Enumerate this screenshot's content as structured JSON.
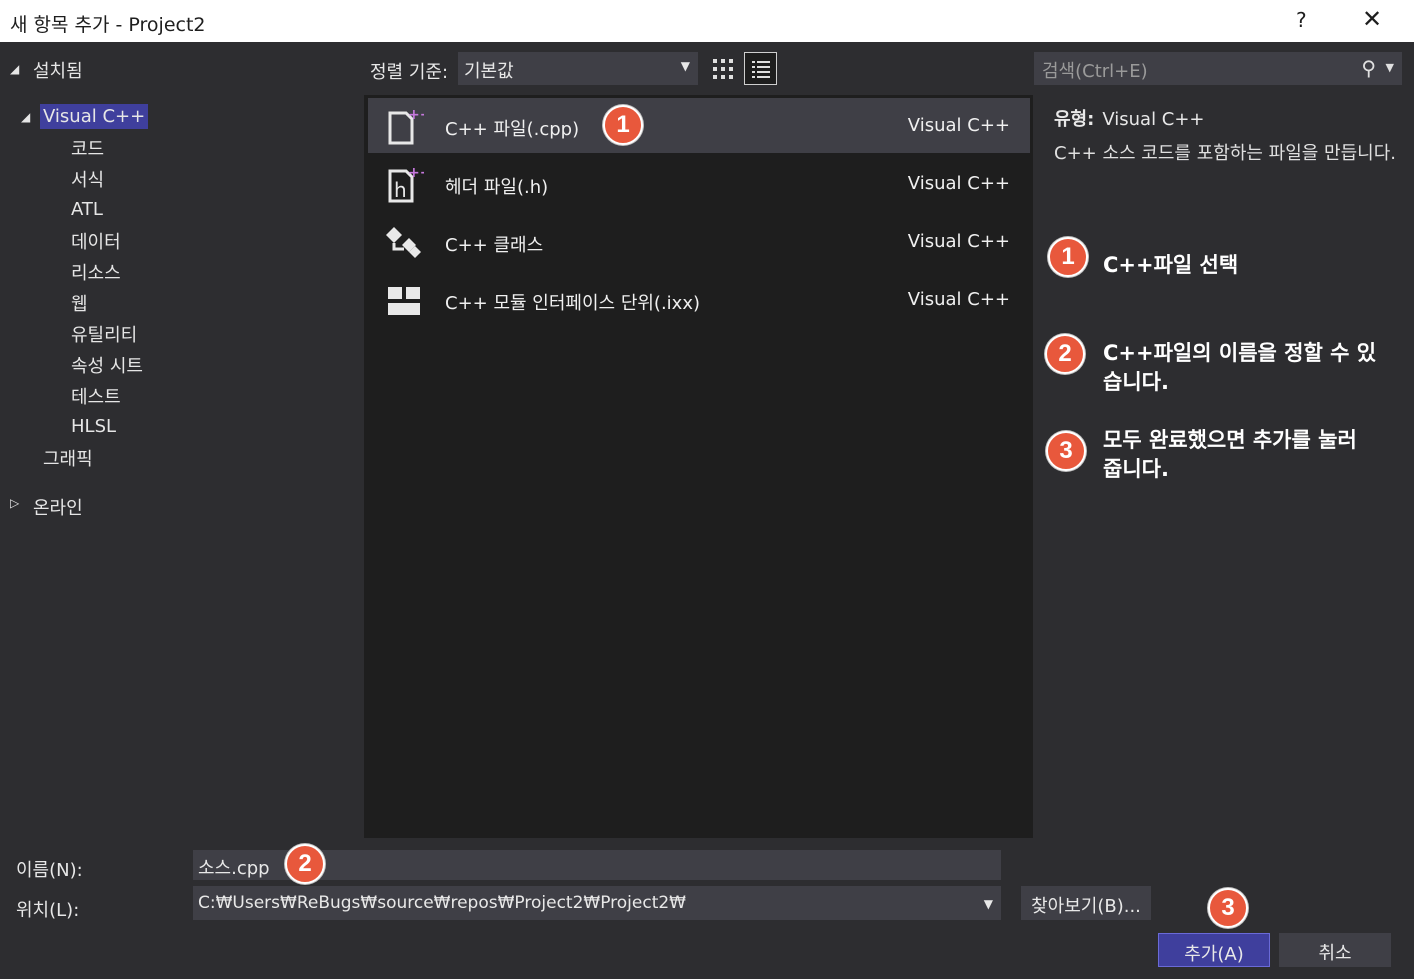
{
  "window": {
    "title": "새 항목 추가 - Project2",
    "help_label": "?",
    "close_label": "✕"
  },
  "sidebar": {
    "installed": "설치됨",
    "visual_cpp": "Visual C++",
    "children": [
      "코드",
      "서식",
      "ATL",
      "데이터",
      "리소스",
      "웹",
      "유틸리티",
      "속성 시트",
      "테스트",
      "HLSL"
    ],
    "graphics": "그래픽",
    "online": "온라인"
  },
  "toolbar": {
    "sort_label": "정렬 기준:",
    "sort_value": "기본값",
    "search_placeholder": "검색(Ctrl+E)"
  },
  "templates": [
    {
      "name": "C++ 파일(.cpp)",
      "type": "Visual C++",
      "icon": "cpp-file-icon",
      "selected": true
    },
    {
      "name": "헤더 파일(.h)",
      "type": "Visual C++",
      "icon": "header-file-icon",
      "selected": false
    },
    {
      "name": "C++ 클래스",
      "type": "Visual C++",
      "icon": "class-icon",
      "selected": false
    },
    {
      "name": "C++ 모듈 인터페이스 단위(.ixx)",
      "type": "Visual C++",
      "icon": "module-icon",
      "selected": false
    }
  ],
  "details": {
    "type_label": "유형:",
    "type_value": "Visual C++",
    "description": "C++ 소스 코드를 포함하는 파일을 만듭니다."
  },
  "annotations": {
    "badge1": "1",
    "badge2": "2",
    "badge3": "3",
    "note1": "C++파일 선택",
    "note2": "C++파일의 이름을 정할 수 있습니다.",
    "note3": "모두 완료했으면 추가를 눌러줍니다."
  },
  "form": {
    "name_label": "이름(N):",
    "name_value": "소스.cpp",
    "location_label": "위치(L):",
    "location_value": "C:₩Users₩ReBugs₩source₩repos₩Project2₩Project2₩",
    "browse_label": "찾아보기(B)...",
    "add_label": "추가(A)",
    "cancel_label": "취소"
  },
  "colors": {
    "accent": "#3f3f9d",
    "badge": "#e8583c",
    "panel": "#1e1e1e",
    "background": "#2d2d30"
  }
}
